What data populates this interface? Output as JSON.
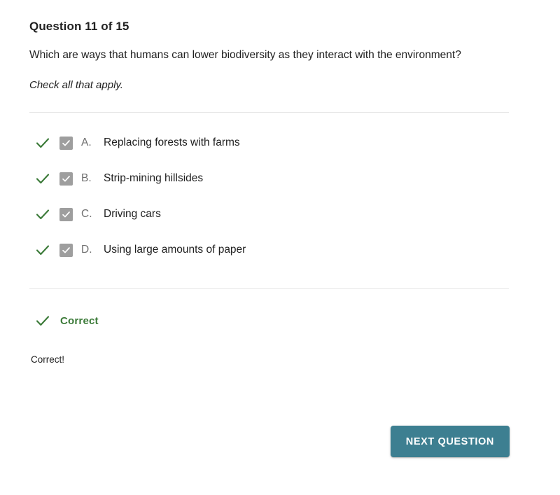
{
  "quiz": {
    "heading": "Question 11 of 15",
    "prompt": "Which are ways that humans can lower biodiversity as they interact with the environment?",
    "sub_prompt": "Check all that apply.",
    "options": [
      {
        "letter": "A.",
        "text": "Replacing forests with farms",
        "checked": true,
        "marked_correct": true
      },
      {
        "letter": "B.",
        "text": "Strip-mining hillsides",
        "checked": true,
        "marked_correct": true
      },
      {
        "letter": "C.",
        "text": "Driving cars",
        "checked": true,
        "marked_correct": true
      },
      {
        "letter": "D.",
        "text": "Using large amounts of paper",
        "checked": true,
        "marked_correct": true
      }
    ],
    "feedback": {
      "status_label": "Correct",
      "body": "Correct!",
      "status_icon": "check-icon"
    },
    "next_button_label": "NEXT QUESTION",
    "colors": {
      "correct_green": "#3b7a38",
      "checkbox_gray": "#9e9e9e",
      "button_teal": "#3d7f91",
      "divider_gray": "#e6e6e6",
      "text_primary": "#212121",
      "letter_gray": "#6f6f6f"
    }
  }
}
